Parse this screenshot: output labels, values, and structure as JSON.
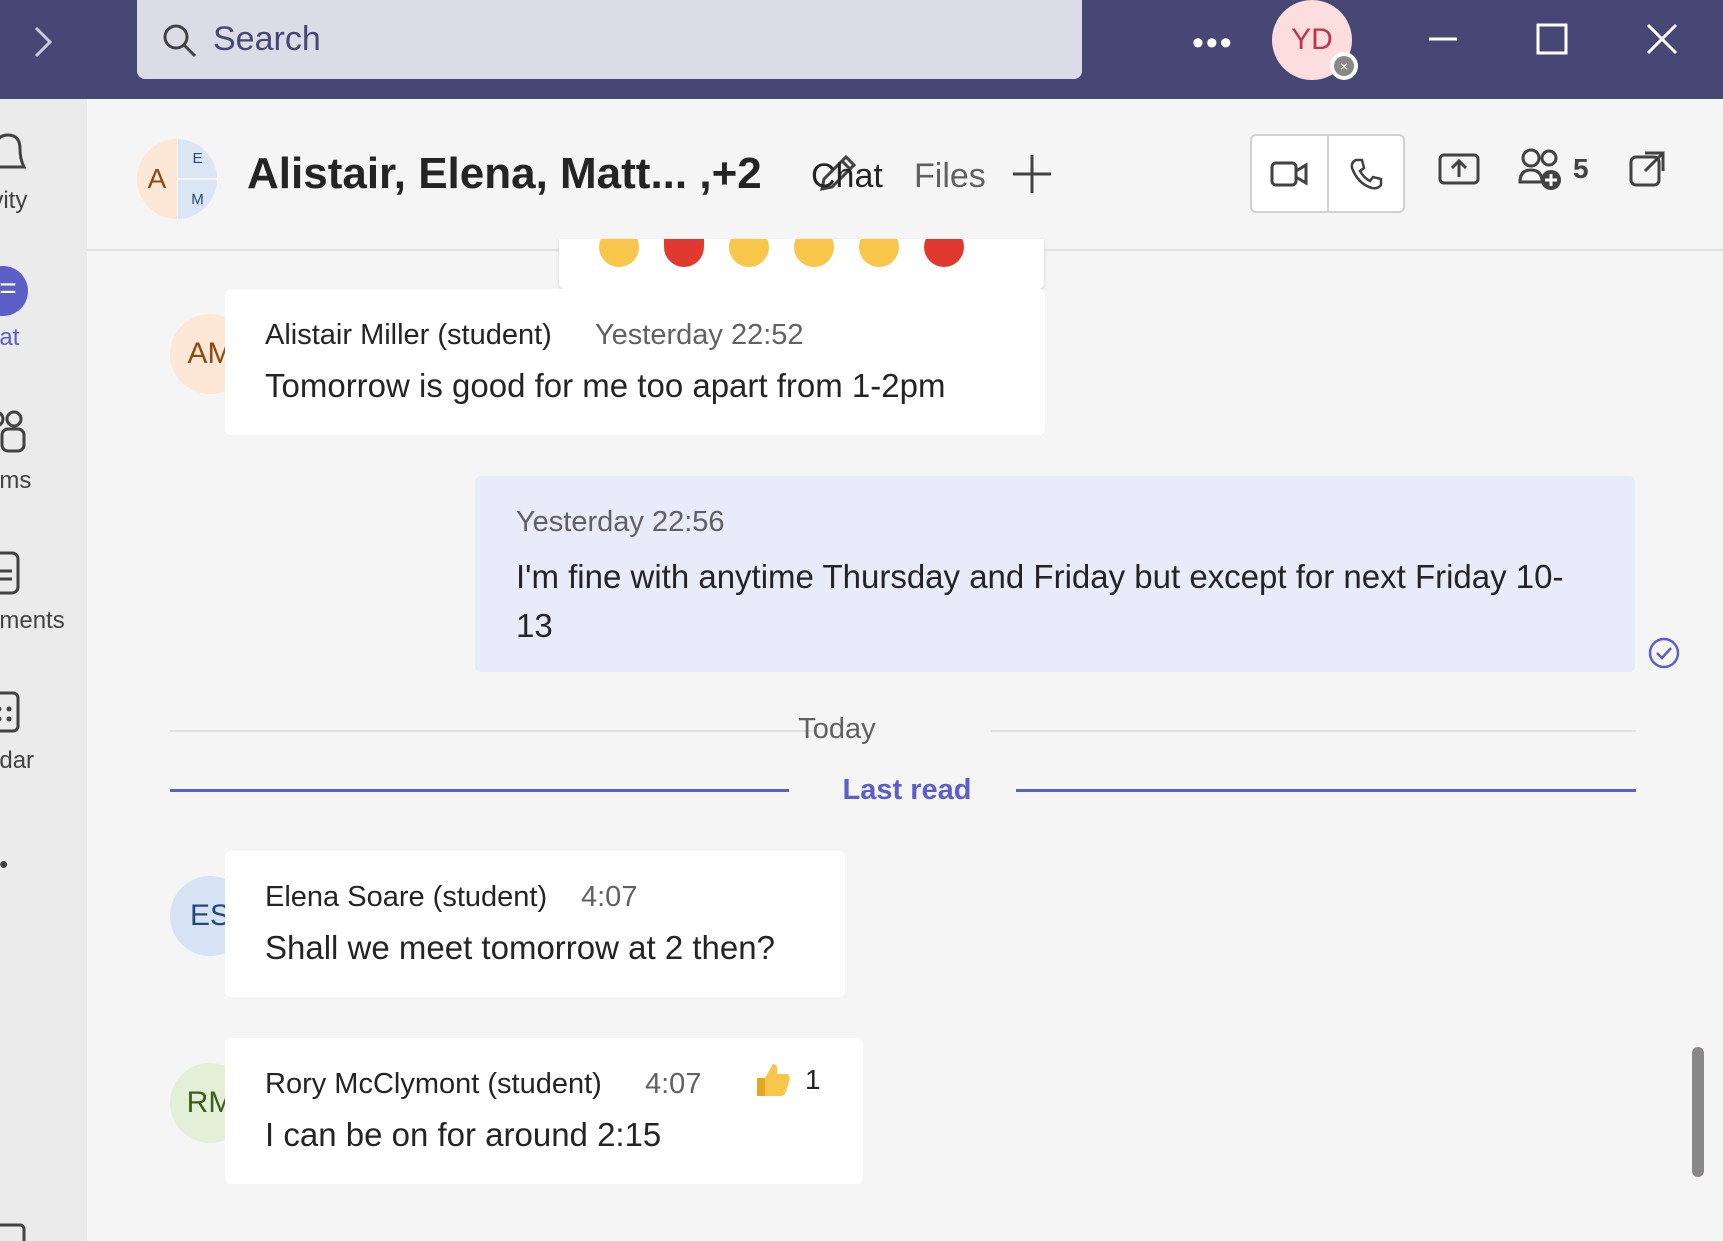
{
  "search": {
    "placeholder": "Search"
  },
  "titlebar": {
    "more_label": "•••",
    "user_initials": "YD"
  },
  "rail": {
    "items": [
      {
        "label": "ivity"
      },
      {
        "label": "hat"
      },
      {
        "label": "ams"
      },
      {
        "label": "nments"
      },
      {
        "label": "ndar"
      },
      {
        "label": "••"
      }
    ]
  },
  "header": {
    "group_initials": {
      "a": "A",
      "e": "E",
      "m": "M"
    },
    "title": "Alistair, Elena, Matt... ,+2",
    "tabs": [
      {
        "label": "Chat"
      },
      {
        "label": "Files"
      }
    ],
    "participants_count": "5"
  },
  "messages": [
    {
      "initials": "AM",
      "name": "Alistair Miller (student)",
      "time": "Yesterday 22:52",
      "text": "Tomorrow is good for me too apart from 1-2pm"
    },
    {
      "initials": "ES",
      "name": "Elena Soare (student)",
      "time": "4:07",
      "text": "Shall we meet tomorrow at 2 then?"
    },
    {
      "initials": "RM",
      "name": "Rory McClymont (student)",
      "time": "4:07",
      "text": "I can be on for around 2:15",
      "reaction_count": "1"
    }
  ],
  "my_message": {
    "time": "Yesterday 22:56",
    "text": "I'm fine with anytime Thursday and Friday but except for next Friday 10-13"
  },
  "dividers": {
    "today": "Today",
    "last_read": "Last read"
  },
  "colors": {
    "titlebar": "#464775",
    "accent": "#5b5fc7",
    "my_bubble": "#e8ebfa",
    "online": "#6bb700"
  }
}
